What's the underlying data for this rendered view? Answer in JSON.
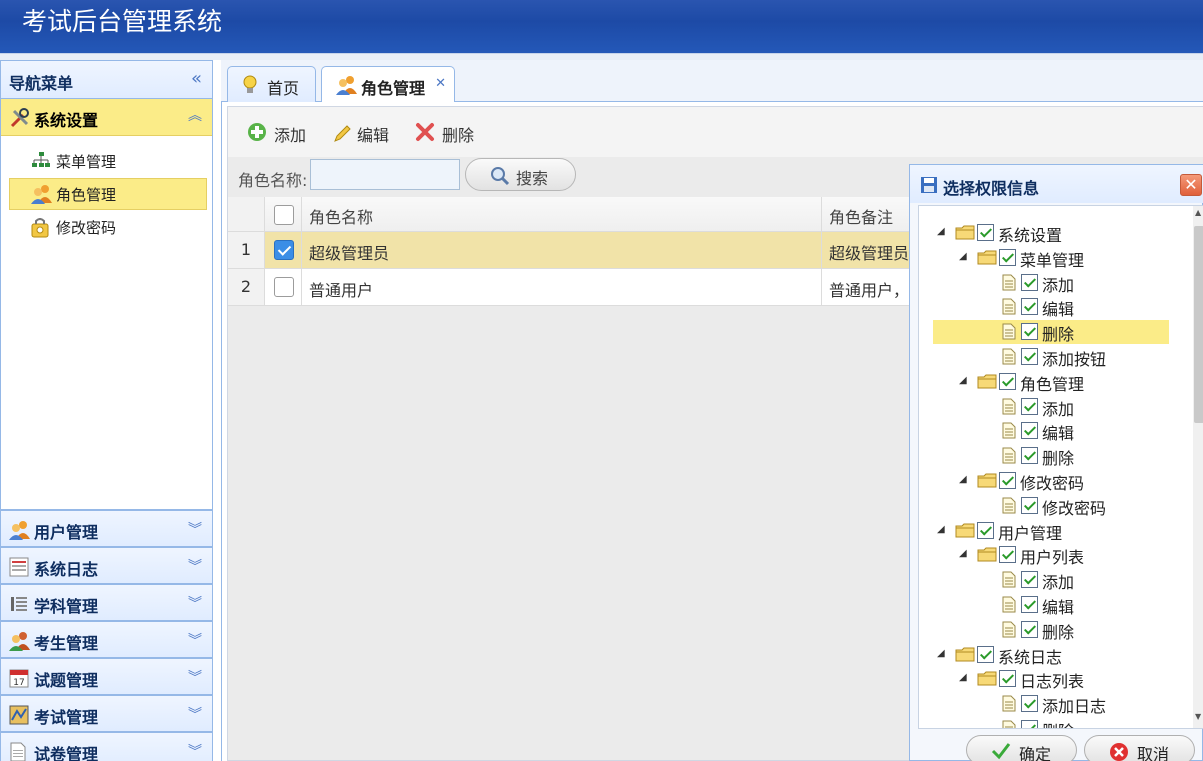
{
  "app": {
    "title": "考试后台管理系统"
  },
  "sidebar": {
    "header": "导航菜单",
    "active_panel": "系统设置",
    "menu_items": [
      {
        "label": "菜单管理",
        "icon": "sitemap-icon"
      },
      {
        "label": "角色管理",
        "icon": "users-icon",
        "selected": true
      },
      {
        "label": "修改密码",
        "icon": "key-icon"
      }
    ],
    "panels": [
      {
        "label": "用户管理",
        "icon": "user-icon"
      },
      {
        "label": "系统日志",
        "icon": "log-icon"
      },
      {
        "label": "学科管理",
        "icon": "list-icon"
      },
      {
        "label": "考生管理",
        "icon": "students-icon"
      },
      {
        "label": "试题管理",
        "icon": "calendar-icon"
      },
      {
        "label": "考试管理",
        "icon": "map-icon"
      },
      {
        "label": "试卷管理",
        "icon": "document-icon"
      }
    ]
  },
  "tabs": [
    {
      "label": "首页",
      "icon": "lightbulb-icon"
    },
    {
      "label": "角色管理",
      "icon": "users-icon",
      "active": true
    }
  ],
  "toolbar": {
    "add": "添加",
    "edit": "编辑",
    "delete": "删除"
  },
  "search": {
    "label": "角色名称:",
    "button": "搜索",
    "value": ""
  },
  "grid": {
    "columns": [
      "角色名称",
      "角色备注"
    ],
    "rows": [
      {
        "num": "1",
        "name": "超级管理员",
        "remark": "超级管理员",
        "checked": true
      },
      {
        "num": "2",
        "name": "普通用户",
        "remark": "普通用户，",
        "checked": false
      }
    ]
  },
  "dialog": {
    "title": "选择权限信息",
    "ok": "确定",
    "cancel": "取消",
    "tree": [
      {
        "label": "系统设置",
        "level": 0,
        "type": "folder"
      },
      {
        "label": "菜单管理",
        "level": 1,
        "type": "folder"
      },
      {
        "label": "添加",
        "level": 2,
        "type": "leaf"
      },
      {
        "label": "编辑",
        "level": 2,
        "type": "leaf"
      },
      {
        "label": "删除",
        "level": 2,
        "type": "leaf",
        "highlight": true
      },
      {
        "label": "添加按钮",
        "level": 2,
        "type": "leaf"
      },
      {
        "label": "角色管理",
        "level": 1,
        "type": "folder"
      },
      {
        "label": "添加",
        "level": 2,
        "type": "leaf"
      },
      {
        "label": "编辑",
        "level": 2,
        "type": "leaf"
      },
      {
        "label": "删除",
        "level": 2,
        "type": "leaf"
      },
      {
        "label": "修改密码",
        "level": 1,
        "type": "folder"
      },
      {
        "label": "修改密码",
        "level": 2,
        "type": "leaf"
      },
      {
        "label": "用户管理",
        "level": 0,
        "type": "folder"
      },
      {
        "label": "用户列表",
        "level": 1,
        "type": "folder"
      },
      {
        "label": "添加",
        "level": 2,
        "type": "leaf"
      },
      {
        "label": "编辑",
        "level": 2,
        "type": "leaf"
      },
      {
        "label": "删除",
        "level": 2,
        "type": "leaf"
      },
      {
        "label": "系统日志",
        "level": 0,
        "type": "folder"
      },
      {
        "label": "日志列表",
        "level": 1,
        "type": "folder"
      },
      {
        "label": "添加日志",
        "level": 2,
        "type": "leaf"
      },
      {
        "label": "删除",
        "level": 2,
        "type": "leaf"
      }
    ]
  },
  "colors": {
    "header_blue": "#1d4aa6",
    "highlight_yellow": "#fbec88",
    "border_blue": "#95b8e7"
  }
}
